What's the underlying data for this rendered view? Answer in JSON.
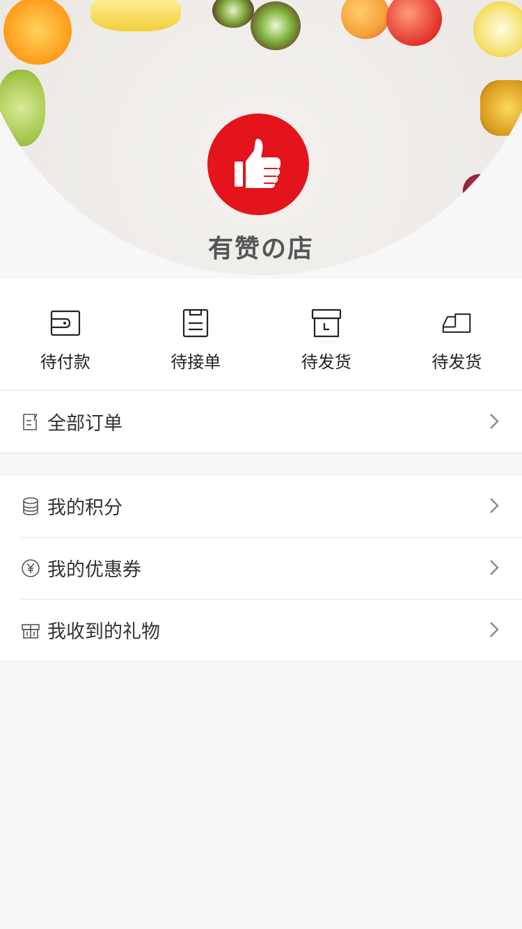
{
  "shop": {
    "name": "有赞の店"
  },
  "colors": {
    "brand": "#e3141c",
    "page_bg": "#f7f7f7"
  },
  "order_status": [
    {
      "label": "待付款",
      "icon": "wallet-icon"
    },
    {
      "label": "待接单",
      "icon": "clipboard-icon"
    },
    {
      "label": "待发货",
      "icon": "box-icon"
    },
    {
      "label": "待发货",
      "icon": "truck-icon"
    }
  ],
  "orders": {
    "all_label": "全部订单",
    "icon": "order-list-icon"
  },
  "account": {
    "items": [
      {
        "label": "我的积分",
        "icon": "coins-icon"
      },
      {
        "label": "我的优惠券",
        "icon": "coupon-icon"
      },
      {
        "label": "我收到的礼物",
        "icon": "gift-icon"
      }
    ]
  }
}
